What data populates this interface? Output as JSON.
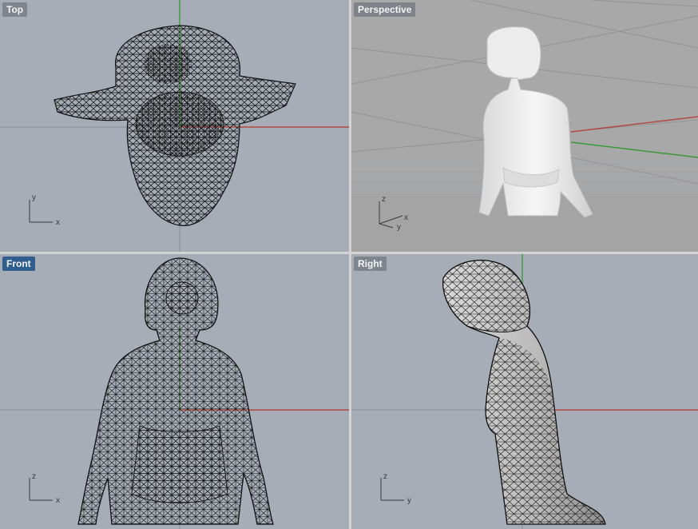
{
  "viewports": {
    "top": {
      "title": "Top",
      "axes": {
        "h": "x",
        "v": "y"
      }
    },
    "perspective": {
      "title": "Perspective",
      "axes": {
        "a": "z",
        "b": "y",
        "c": "x"
      }
    },
    "front": {
      "title": "Front",
      "axes": {
        "h": "x",
        "v": "z"
      }
    },
    "right": {
      "title": "Right",
      "axes": {
        "h": "y",
        "v": "z"
      }
    }
  },
  "active_viewport": "Front",
  "colors": {
    "viewport_bg": "#a7adb6",
    "perspective_bg": "#a8a8a8",
    "x_axis": "#b14a44",
    "y_axis": "#3a9a3a",
    "grid_line": "#8a9099",
    "mesh": "#111111"
  }
}
